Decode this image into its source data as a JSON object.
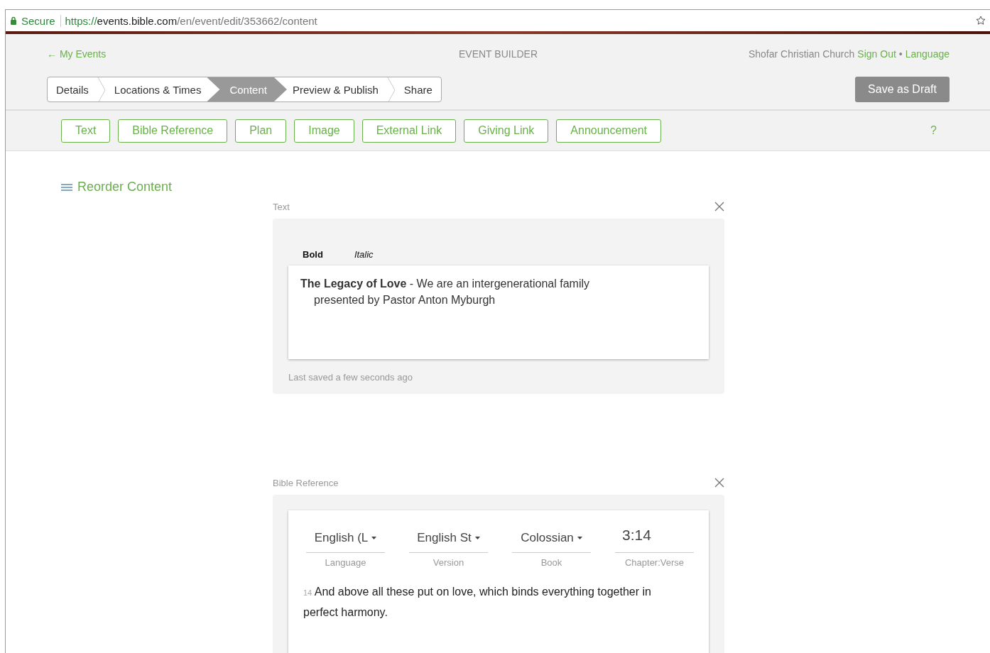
{
  "browser": {
    "secure_label": "Secure",
    "url": {
      "scheme": "https://",
      "host": "events.bible.com",
      "path": "/en/event/edit/353662/content"
    }
  },
  "header": {
    "back_link": "← My Events",
    "title": "EVENT BUILDER",
    "account": "Shofar Christian Church",
    "sign_out": "Sign Out",
    "separator": "•",
    "language": "Language"
  },
  "steps": [
    {
      "label": "Details",
      "selected": false
    },
    {
      "label": "Locations & Times",
      "selected": false
    },
    {
      "label": "Content",
      "selected": true
    },
    {
      "label": "Preview & Publish",
      "selected": false
    },
    {
      "label": "Share",
      "selected": false
    }
  ],
  "save_button": "Save as Draft",
  "add_buttons": [
    "Text",
    "Bible Reference",
    "Plan",
    "Image",
    "External Link",
    "Giving Link",
    "Announcement"
  ],
  "help": "?",
  "reorder": "Reorder Content",
  "blocks": [
    {
      "kind": "text",
      "label": "Text",
      "format_buttons": [
        {
          "kind": "bold",
          "label": "Bold"
        },
        {
          "kind": "italic",
          "label": "Italic"
        }
      ],
      "lines": [
        "**The Legacy of Love** - We are an intergenerational family",
        "presented by Pastor Anton Myburgh"
      ],
      "status": "Last saved a few seconds ago"
    },
    {
      "kind": "bible",
      "label": "Bible Reference",
      "fields": [
        {
          "kind": "select",
          "value": "English (L",
          "label": "Language"
        },
        {
          "kind": "select",
          "value": "English St",
          "label": "Version"
        },
        {
          "kind": "select",
          "value": "Colossian",
          "label": "Book"
        },
        {
          "kind": "input",
          "value": "3:14",
          "label": "Chapter:Verse"
        }
      ],
      "verse": "$_{14}$ And above all these put on love, which binds everything together in perfect harmony."
    }
  ]
}
